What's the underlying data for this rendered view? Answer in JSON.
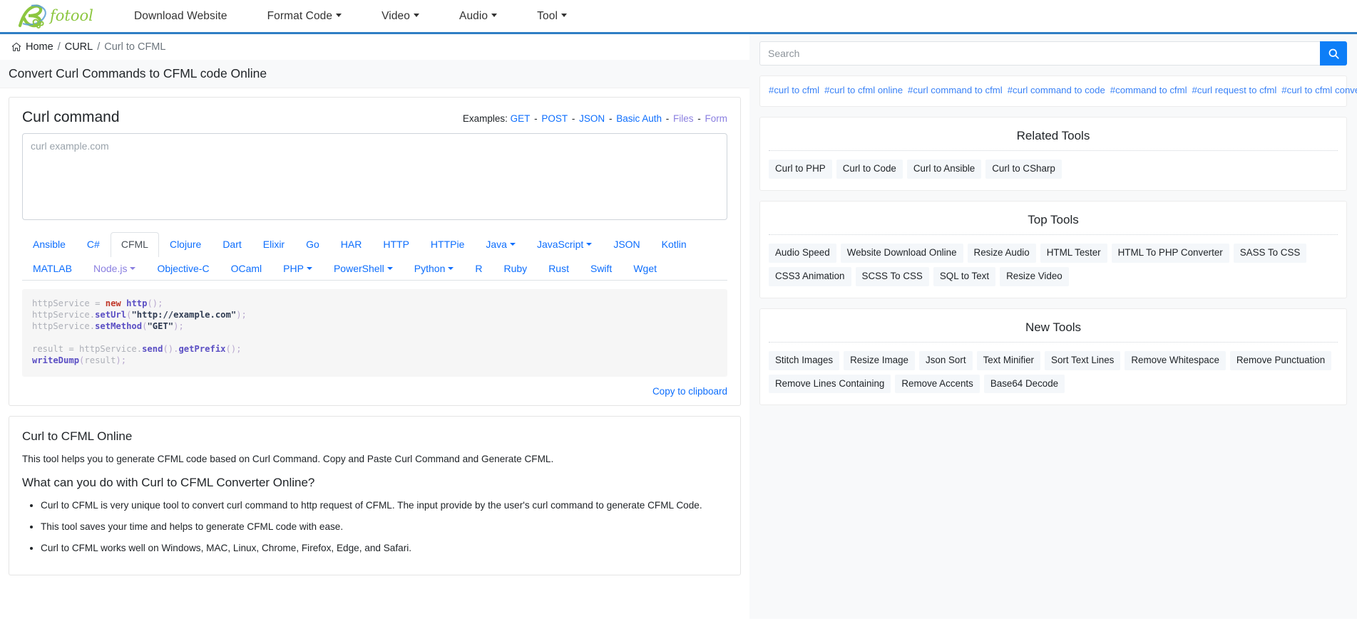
{
  "nav": {
    "logo_text": "Bfotool",
    "items": [
      {
        "label": "Download Website",
        "has_caret": false
      },
      {
        "label": "Format Code",
        "has_caret": true
      },
      {
        "label": "Video",
        "has_caret": true
      },
      {
        "label": "Audio",
        "has_caret": true
      },
      {
        "label": "Tool",
        "has_caret": true
      }
    ]
  },
  "breadcrumb": {
    "home": "Home",
    "sep": "/",
    "category": "CURL",
    "current": "Curl to CFML"
  },
  "page_title": "Convert Curl Commands to CFML code Online",
  "converter": {
    "card_title": "Curl command",
    "examples_label": "Examples:",
    "examples": [
      {
        "label": "GET",
        "visited": false
      },
      {
        "label": "POST",
        "visited": false
      },
      {
        "label": "JSON",
        "visited": false
      },
      {
        "label": "Basic Auth",
        "visited": false
      },
      {
        "label": "Files",
        "visited": true
      },
      {
        "label": "Form",
        "visited": true
      }
    ],
    "input_placeholder": "curl example.com",
    "input_value": "",
    "copy_label": "Copy to clipboard"
  },
  "lang_tabs": [
    {
      "label": "Ansible",
      "active": false,
      "caret": false,
      "visited": false
    },
    {
      "label": "C#",
      "active": false,
      "caret": false,
      "visited": false
    },
    {
      "label": "CFML",
      "active": true,
      "caret": false,
      "visited": false
    },
    {
      "label": "Clojure",
      "active": false,
      "caret": false,
      "visited": false
    },
    {
      "label": "Dart",
      "active": false,
      "caret": false,
      "visited": false
    },
    {
      "label": "Elixir",
      "active": false,
      "caret": false,
      "visited": false
    },
    {
      "label": "Go",
      "active": false,
      "caret": false,
      "visited": false
    },
    {
      "label": "HAR",
      "active": false,
      "caret": false,
      "visited": false
    },
    {
      "label": "HTTP",
      "active": false,
      "caret": false,
      "visited": false
    },
    {
      "label": "HTTPie",
      "active": false,
      "caret": false,
      "visited": false
    },
    {
      "label": "Java",
      "active": false,
      "caret": true,
      "visited": false
    },
    {
      "label": "JavaScript",
      "active": false,
      "caret": true,
      "visited": false
    },
    {
      "label": "JSON",
      "active": false,
      "caret": false,
      "visited": false
    },
    {
      "label": "Kotlin",
      "active": false,
      "caret": false,
      "visited": false
    },
    {
      "label": "MATLAB",
      "active": false,
      "caret": false,
      "visited": false
    },
    {
      "label": "Node.js",
      "active": false,
      "caret": true,
      "visited": true
    },
    {
      "label": "Objective-C",
      "active": false,
      "caret": false,
      "visited": false
    },
    {
      "label": "OCaml",
      "active": false,
      "caret": false,
      "visited": false
    },
    {
      "label": "PHP",
      "active": false,
      "caret": true,
      "visited": false
    },
    {
      "label": "PowerShell",
      "active": false,
      "caret": true,
      "visited": false
    },
    {
      "label": "Python",
      "active": false,
      "caret": true,
      "visited": false
    },
    {
      "label": "R",
      "active": false,
      "caret": false,
      "visited": false
    },
    {
      "label": "Ruby",
      "active": false,
      "caret": false,
      "visited": false
    },
    {
      "label": "Rust",
      "active": false,
      "caret": false,
      "visited": false
    },
    {
      "label": "Swift",
      "active": false,
      "caret": false,
      "visited": false
    },
    {
      "label": "Wget",
      "active": false,
      "caret": false,
      "visited": false
    }
  ],
  "code_output": {
    "language": "CFML",
    "lines": [
      [
        {
          "t": "httpService ",
          "c": "c-var"
        },
        {
          "t": "= ",
          "c": "c-op"
        },
        {
          "t": "new ",
          "c": "c-kw"
        },
        {
          "t": "http",
          "c": "c-fn"
        },
        {
          "t": "();",
          "c": "c-pn"
        }
      ],
      [
        {
          "t": "httpService.",
          "c": "c-var"
        },
        {
          "t": "setUrl",
          "c": "c-fn"
        },
        {
          "t": "(",
          "c": "c-pn"
        },
        {
          "t": "\"http://example.com\"",
          "c": "c-str"
        },
        {
          "t": ");",
          "c": "c-pn"
        }
      ],
      [
        {
          "t": "httpService.",
          "c": "c-var"
        },
        {
          "t": "setMethod",
          "c": "c-fn"
        },
        {
          "t": "(",
          "c": "c-pn"
        },
        {
          "t": "\"GET\"",
          "c": "c-str"
        },
        {
          "t": ");",
          "c": "c-pn"
        }
      ],
      [
        {
          "t": "",
          "c": "c-var"
        }
      ],
      [
        {
          "t": "result = httpService.",
          "c": "c-var"
        },
        {
          "t": "send",
          "c": "c-fn"
        },
        {
          "t": "().",
          "c": "c-pn"
        },
        {
          "t": "getPrefix",
          "c": "c-fn"
        },
        {
          "t": "();",
          "c": "c-pn"
        }
      ],
      [
        {
          "t": "writeDump",
          "c": "c-fn"
        },
        {
          "t": "(",
          "c": "c-pn"
        },
        {
          "t": "result",
          "c": "c-var"
        },
        {
          "t": ");",
          "c": "c-pn"
        }
      ]
    ]
  },
  "article": {
    "heading1": "Curl to CFML Online",
    "paragraph1": "This tool helps you to generate CFML code based on Curl Command. Copy and Paste Curl Command and Generate CFML.",
    "heading2": "What can you do with Curl to CFML Converter Online?",
    "bullets": [
      "Curl to CFML is very unique tool to convert curl command to http request of CFML. The input provide by the user's curl command to generate CFML Code.",
      "This tool saves your time and helps to generate CFML code with ease.",
      "Curl to CFML works well on Windows, MAC, Linux, Chrome, Firefox, Edge, and Safari."
    ]
  },
  "sidebar": {
    "search": {
      "placeholder": "Search",
      "value": "",
      "button_icon": "search-icon"
    },
    "tags": [
      "#curl to cfml",
      "#curl to cfml online",
      "#curl command to cfml",
      "#curl command to code",
      "#command to cfml",
      "#curl request to cfml",
      "#curl to cfml converter"
    ],
    "related_tools": {
      "title": "Related Tools",
      "items": [
        "Curl to PHP",
        "Curl to Code",
        "Curl to Ansible",
        "Curl to CSharp"
      ]
    },
    "top_tools": {
      "title": "Top Tools",
      "items": [
        "Audio Speed",
        "Website Download Online",
        "Resize Audio",
        "HTML Tester",
        "HTML To PHP Converter",
        "SASS To CSS",
        "CSS3 Animation",
        "SCSS To CSS",
        "SQL to Text",
        "Resize Video"
      ]
    },
    "new_tools": {
      "title": "New Tools",
      "items": [
        "Stitch Images",
        "Resize Image",
        "Json Sort",
        "Text Minifier",
        "Sort Text Lines",
        "Remove Whitespace",
        "Remove Punctuation",
        "Remove Lines Containing",
        "Remove Accents",
        "Base64 Decode"
      ]
    }
  },
  "colors": {
    "accent_blue": "#0d6efd",
    "search_button": "#0d7ef7",
    "header_rule": "#2f7ec4",
    "logo_green": "#8cc63f",
    "logo_blue": "#4a90d9",
    "pill_bg": "#f4f7fa",
    "tag_link": "#3a82f7",
    "visited_link": "#8a7fe0"
  }
}
